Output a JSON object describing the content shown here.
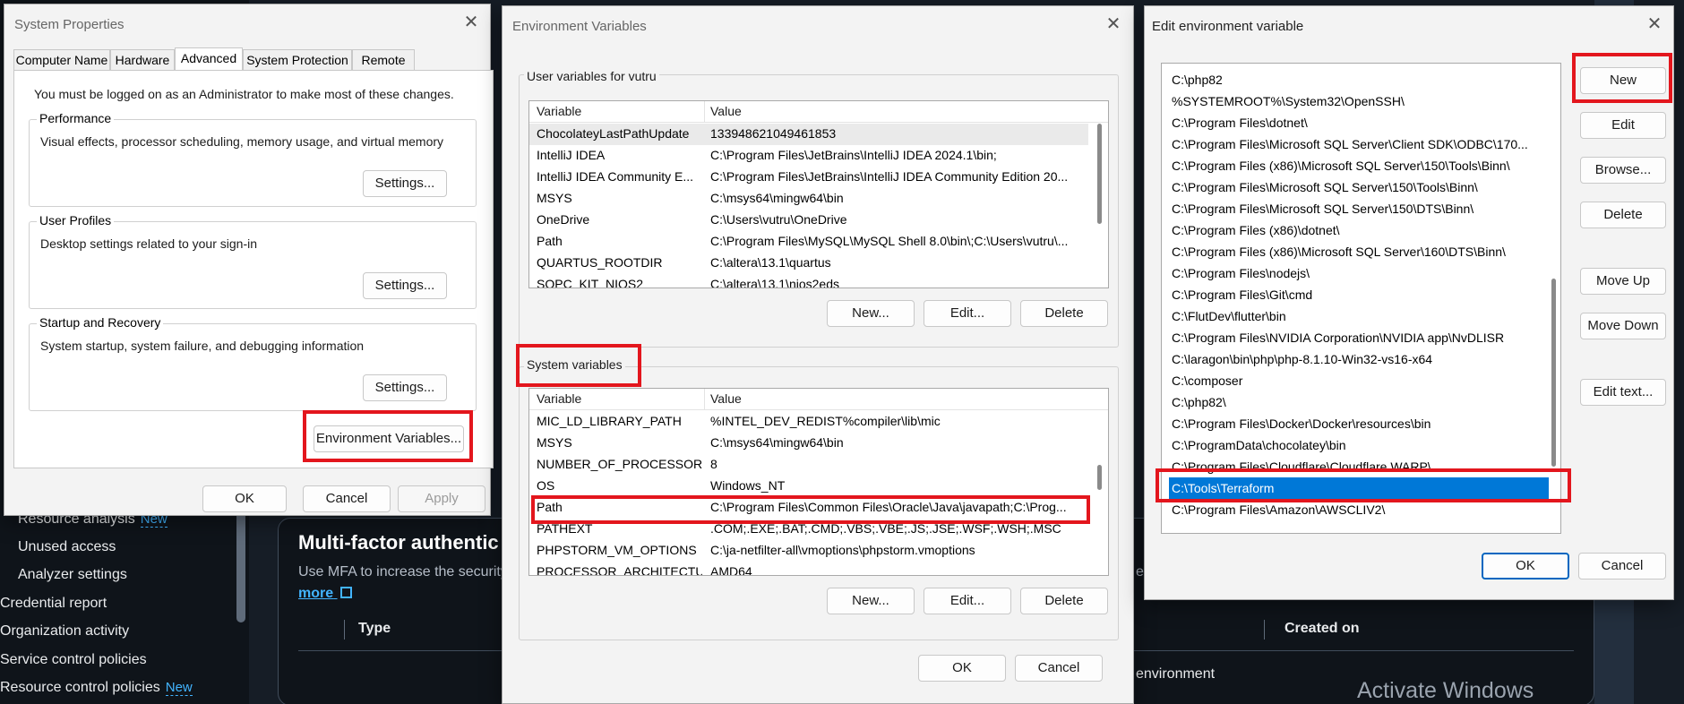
{
  "aws": {
    "nav": {
      "resource_analysis": "Resource analysis",
      "resource_analysis_badge": "New",
      "unused_access": "Unused access",
      "analyzer_settings": "Analyzer settings",
      "credential_report": "Credential report",
      "organization_activity": "Organization activity",
      "service_control_policies": "Service control policies",
      "resource_control_policies": "Resource control policies",
      "resource_control_policies_badge": "New"
    },
    "mfa_heading": "Multi-factor authentic",
    "mfa_desc": "Use MFA to increase the security",
    "mfa_desc_tail": "e",
    "learn_more": "more",
    "columns": {
      "type": "Type",
      "created_on": "Created on"
    },
    "row_fragment": "environment"
  },
  "watermark": "Activate Windows",
  "system_properties": {
    "title": "System Properties",
    "tabs": [
      "Computer Name",
      "Hardware",
      "Advanced",
      "System Protection",
      "Remote"
    ],
    "admin_note": "You must be logged on as an Administrator to make most of these changes.",
    "performance": {
      "title": "Performance",
      "desc": "Visual effects, processor scheduling, memory usage, and virtual memory",
      "button": "Settings..."
    },
    "user_profiles": {
      "title": "User Profiles",
      "desc": "Desktop settings related to your sign-in",
      "button": "Settings..."
    },
    "startup": {
      "title": "Startup and Recovery",
      "desc": "System startup, system failure, and debugging information",
      "button": "Settings..."
    },
    "env_button": "Environment Variables...",
    "ok": "OK",
    "cancel": "Cancel",
    "apply": "Apply"
  },
  "environment_variables": {
    "title": "Environment Variables",
    "user_section": "User variables for vutru",
    "system_section": "System variables",
    "columns": {
      "variable": "Variable",
      "value": "Value"
    },
    "user_vars": [
      {
        "name": "ChocolateyLastPathUpdate",
        "value": "133948621049461853"
      },
      {
        "name": "IntelliJ IDEA",
        "value": "C:\\Program Files\\JetBrains\\IntelliJ IDEA 2024.1\\bin;"
      },
      {
        "name": "IntelliJ IDEA Community E...",
        "value": "C:\\Program Files\\JetBrains\\IntelliJ IDEA Community Edition 20..."
      },
      {
        "name": "MSYS",
        "value": "C:\\msys64\\mingw64\\bin"
      },
      {
        "name": "OneDrive",
        "value": "C:\\Users\\vutru\\OneDrive"
      },
      {
        "name": "Path",
        "value": "C:\\Program Files\\MySQL\\MySQL Shell 8.0\\bin\\;C:\\Users\\vutru\\..."
      },
      {
        "name": "QUARTUS_ROOTDIR",
        "value": "C:\\altera\\13.1\\quartus"
      },
      {
        "name": "SOPC_KIT_NIOS2",
        "value": "C:\\altera\\13.1\\nios2eds"
      }
    ],
    "system_vars": [
      {
        "name": "MIC_LD_LIBRARY_PATH",
        "value": "%INTEL_DEV_REDIST%compiler\\lib\\mic"
      },
      {
        "name": "MSYS",
        "value": "C:\\msys64\\mingw64\\bin"
      },
      {
        "name": "NUMBER_OF_PROCESSORS",
        "value": "8"
      },
      {
        "name": "OS",
        "value": "Windows_NT"
      },
      {
        "name": "Path",
        "value": "C:\\Program Files\\Common Files\\Oracle\\Java\\javapath;C:\\Prog..."
      },
      {
        "name": "PATHEXT",
        "value": ".COM;.EXE;.BAT;.CMD;.VBS;.VBE;.JS;.JSE;.WSF;.WSH;.MSC"
      },
      {
        "name": "PHPSTORM_VM_OPTIONS",
        "value": "C:\\ja-netfilter-all\\vmoptions\\phpstorm.vmoptions"
      },
      {
        "name": "PROCESSOR_ARCHITECTU...",
        "value": "AMD64"
      }
    ],
    "user_buttons": {
      "new": "New...",
      "edit": "Edit...",
      "delete": "Delete"
    },
    "system_buttons": {
      "new": "New...",
      "edit": "Edit...",
      "delete": "Delete"
    },
    "ok": "OK",
    "cancel": "Cancel"
  },
  "edit_env": {
    "title": "Edit environment variable",
    "items": [
      "C:\\php82",
      "%SYSTEMROOT%\\System32\\OpenSSH\\",
      "C:\\Program Files\\dotnet\\",
      "C:\\Program Files\\Microsoft SQL Server\\Client SDK\\ODBC\\170...",
      "C:\\Program Files (x86)\\Microsoft SQL Server\\150\\Tools\\Binn\\",
      "C:\\Program Files\\Microsoft SQL Server\\150\\Tools\\Binn\\",
      "C:\\Program Files\\Microsoft SQL Server\\150\\DTS\\Binn\\",
      "C:\\Program Files (x86)\\dotnet\\",
      "C:\\Program Files (x86)\\Microsoft SQL Server\\160\\DTS\\Binn\\",
      "C:\\Program Files\\nodejs\\",
      "C:\\Program Files\\Git\\cmd",
      "C:\\FlutDev\\flutter\\bin",
      "C:\\Program Files\\NVIDIA Corporation\\NVIDIA app\\NvDLISR",
      "C:\\laragon\\bin\\php\\php-8.1.10-Win32-vs16-x64",
      "C:\\composer",
      "C:\\php82\\",
      "C:\\Program Files\\Docker\\Docker\\resources\\bin",
      "C:\\ProgramData\\chocolatey\\bin",
      "C:\\Program Files\\Cloudflare\\Cloudflare WARP\\",
      "C:\\Tools\\Terraform",
      "C:\\Program Files\\Amazon\\AWSCLIV2\\"
    ],
    "selected_index": 19,
    "buttons": {
      "new": "New",
      "edit": "Edit",
      "browse": "Browse...",
      "delete": "Delete",
      "move_up": "Move Up",
      "move_down": "Move Down",
      "edit_text": "Edit text..."
    },
    "ok": "OK",
    "cancel": "Cancel"
  },
  "colors": {
    "highlight_red": "#e3161d",
    "selection_blue": "#0078d7",
    "aws_link": "#42b4ff",
    "primary_border": "#0067c0"
  }
}
